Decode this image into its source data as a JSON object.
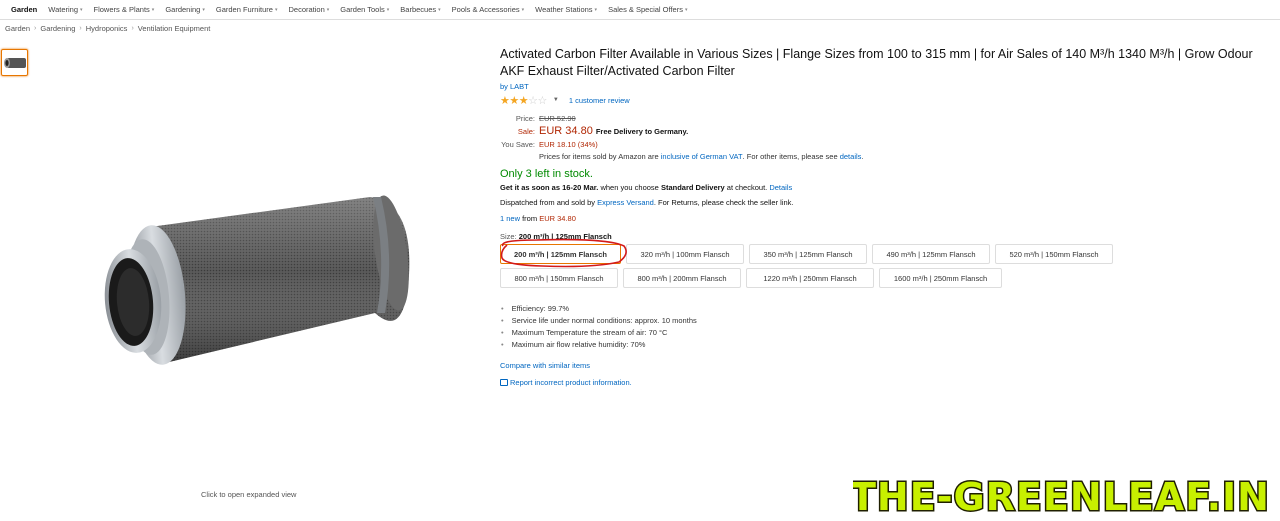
{
  "nav": {
    "items": [
      {
        "label": "Garden",
        "caret": false
      },
      {
        "label": "Watering",
        "caret": true
      },
      {
        "label": "Flowers & Plants",
        "caret": true
      },
      {
        "label": "Gardening",
        "caret": true
      },
      {
        "label": "Garden Furniture",
        "caret": true
      },
      {
        "label": "Decoration",
        "caret": true
      },
      {
        "label": "Garden Tools",
        "caret": true
      },
      {
        "label": "Barbecues",
        "caret": true
      },
      {
        "label": "Pools & Accessories",
        "caret": true
      },
      {
        "label": "Weather Stations",
        "caret": true
      },
      {
        "label": "Sales & Special Offers",
        "caret": true
      }
    ]
  },
  "breadcrumb": [
    "Garden",
    "Gardening",
    "Hydroponics",
    "Ventilation Equipment"
  ],
  "image": {
    "expand_hint": "Click to open expanded view"
  },
  "product": {
    "title": "Activated Carbon Filter Available in Various Sizes | Flange Sizes from 100 to 315 mm | for Air Sales of 140 M³/h 1340 M³/h | Grow Odour AKF Exhaust Filter/Activated Carbon Filter",
    "brand": "by LABT",
    "rating": 3,
    "rating_max": 5,
    "review_link": "1 customer review",
    "price_label": "Price:",
    "price": "EUR 52.90",
    "sale_label": "Sale:",
    "sale_price": "EUR 34.80",
    "free_delivery": "Free Delivery to Germany.",
    "save_label": "You Save:",
    "save_value": "EUR 18.10 (34%)",
    "vat_prefix": "Prices for items sold by Amazon are ",
    "vat_link": "inclusive of German VAT",
    "vat_suffix": ". For other items, please see ",
    "vat_details": "details",
    "vat_end": ".",
    "stock": "Only 3 left in stock.",
    "delivery_prefix": "Get it as soon as 16-20 Mar.",
    "delivery_mid": " when you choose ",
    "delivery_bold": "Standard Delivery",
    "delivery_suffix": " at checkout. ",
    "delivery_details": "Details",
    "dispatch_prefix": "Dispatched from and sold by ",
    "dispatch_seller": "Express Versand",
    "dispatch_suffix": ". For Returns, please check the seller link.",
    "offers_link": "1 new",
    "offers_from": " from ",
    "offers_price": "EUR 34.80",
    "size_label": "Size: ",
    "size_value": "200 m³/h | 125mm Flansch",
    "variants": [
      {
        "label": "200 m³/h | 125mm Flansch",
        "selected": true
      },
      {
        "label": "320 m³/h | 100mm Flansch",
        "selected": false
      },
      {
        "label": "350 m³/h | 125mm Flansch",
        "selected": false
      },
      {
        "label": "490 m³/h | 125mm Flansch",
        "selected": false
      },
      {
        "label": "520 m³/h | 150mm Flansch",
        "selected": false
      },
      {
        "label": "800 m³/h | 150mm Flansch",
        "selected": false
      },
      {
        "label": "800 m³/h | 200mm Flansch",
        "selected": false
      },
      {
        "label": "1220 m³/h | 250mm Flansch",
        "selected": false
      },
      {
        "label": "1600 m³/h | 250mm Flansch",
        "selected": false
      }
    ],
    "bullets": [
      "Efficiency: 99.7%",
      "Service life under normal conditions: approx. 10 months",
      "Maximum Temperature the stream of air: 70 °C",
      "Maximum air flow relative humidity: 70%"
    ],
    "compare_link": "Compare with similar items",
    "report_link": "Report incorrect product information."
  },
  "watermark": "THE-GREENLEAF.IN",
  "colors": {
    "link": "#0066c0",
    "price_red": "#b12704",
    "stock_green": "#008a00",
    "selection_orange": "#e77600",
    "annotation_red": "#d31a1a",
    "watermark_fill": "#c8f000"
  }
}
